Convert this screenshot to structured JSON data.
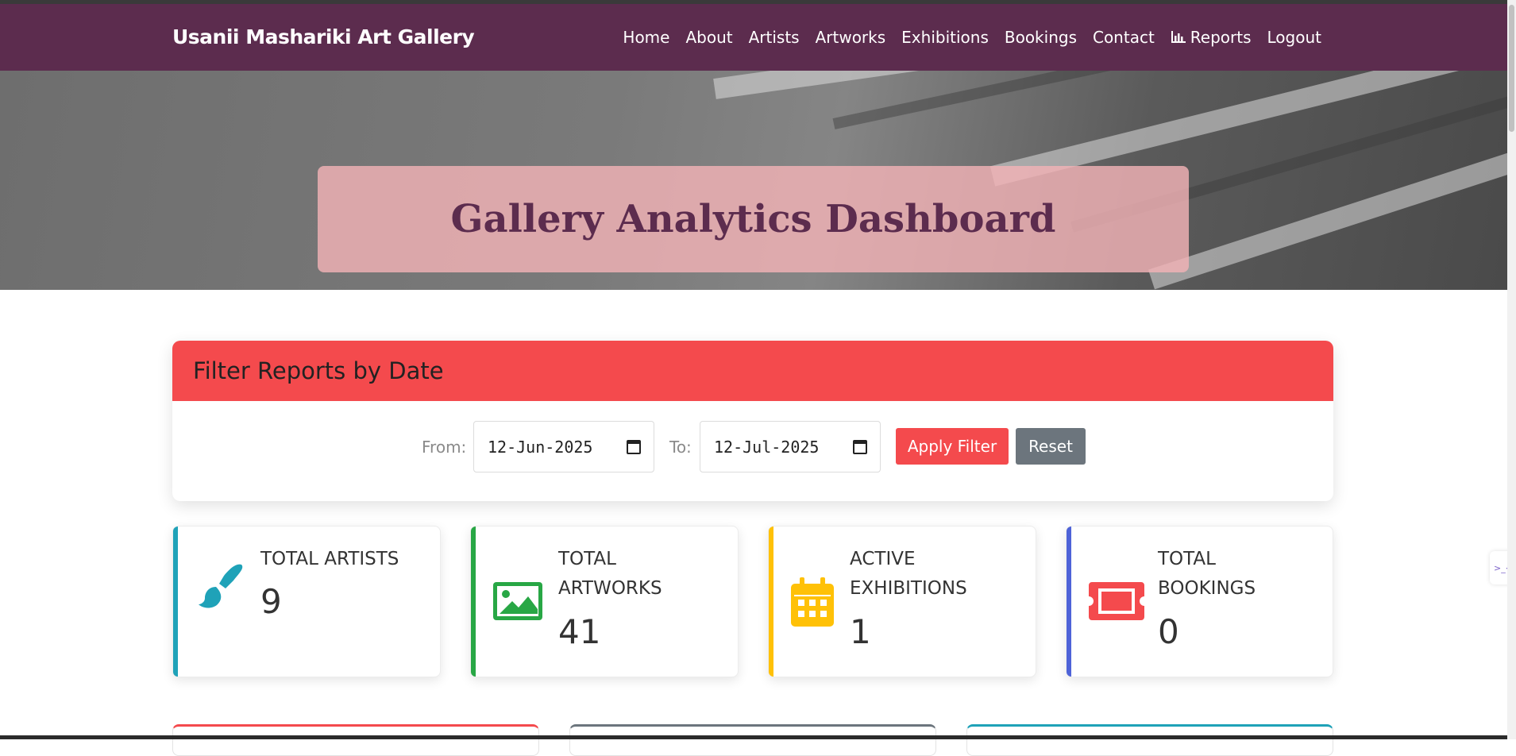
{
  "brand": "Usanii Mashariki Art Gallery",
  "nav": {
    "items": [
      {
        "label": "Home"
      },
      {
        "label": "About"
      },
      {
        "label": "Artists"
      },
      {
        "label": "Artworks"
      },
      {
        "label": "Exhibitions"
      },
      {
        "label": "Bookings"
      },
      {
        "label": "Contact"
      },
      {
        "label": "Reports",
        "icon": "chart-bar-icon"
      },
      {
        "label": "Logout"
      }
    ]
  },
  "hero": {
    "title": "Gallery Analytics Dashboard"
  },
  "filter": {
    "title": "Filter Reports by Date",
    "from_label": "From:",
    "from_value": "12-Jun-2025",
    "to_label": "To:",
    "to_value": "12-Jul-2025",
    "apply_label": "Apply Filter",
    "reset_label": "Reset"
  },
  "stats": [
    {
      "label_line1": "TOTAL ARTISTS",
      "label_line2": "",
      "value": "9",
      "icon": "paint-brush-icon",
      "color": "#1fa2b8"
    },
    {
      "label_line1": "TOTAL",
      "label_line2": "ARTWORKS",
      "value": "41",
      "icon": "image-icon",
      "color": "#28a745"
    },
    {
      "label_line1": "ACTIVE",
      "label_line2": "EXHIBITIONS",
      "value": "1",
      "icon": "calendar-icon",
      "color": "#ffc107"
    },
    {
      "label_line1": "TOTAL",
      "label_line2": "BOOKINGS",
      "value": "0",
      "icon": "ticket-icon",
      "color": "#f44a4d"
    }
  ],
  "colors": {
    "navbar": "#5c2c4e",
    "accent_red": "#f44a4d",
    "reset_gray": "#6c757d",
    "bookings_bar": "#4e63d8"
  },
  "side_widget_glyph": ">_<"
}
